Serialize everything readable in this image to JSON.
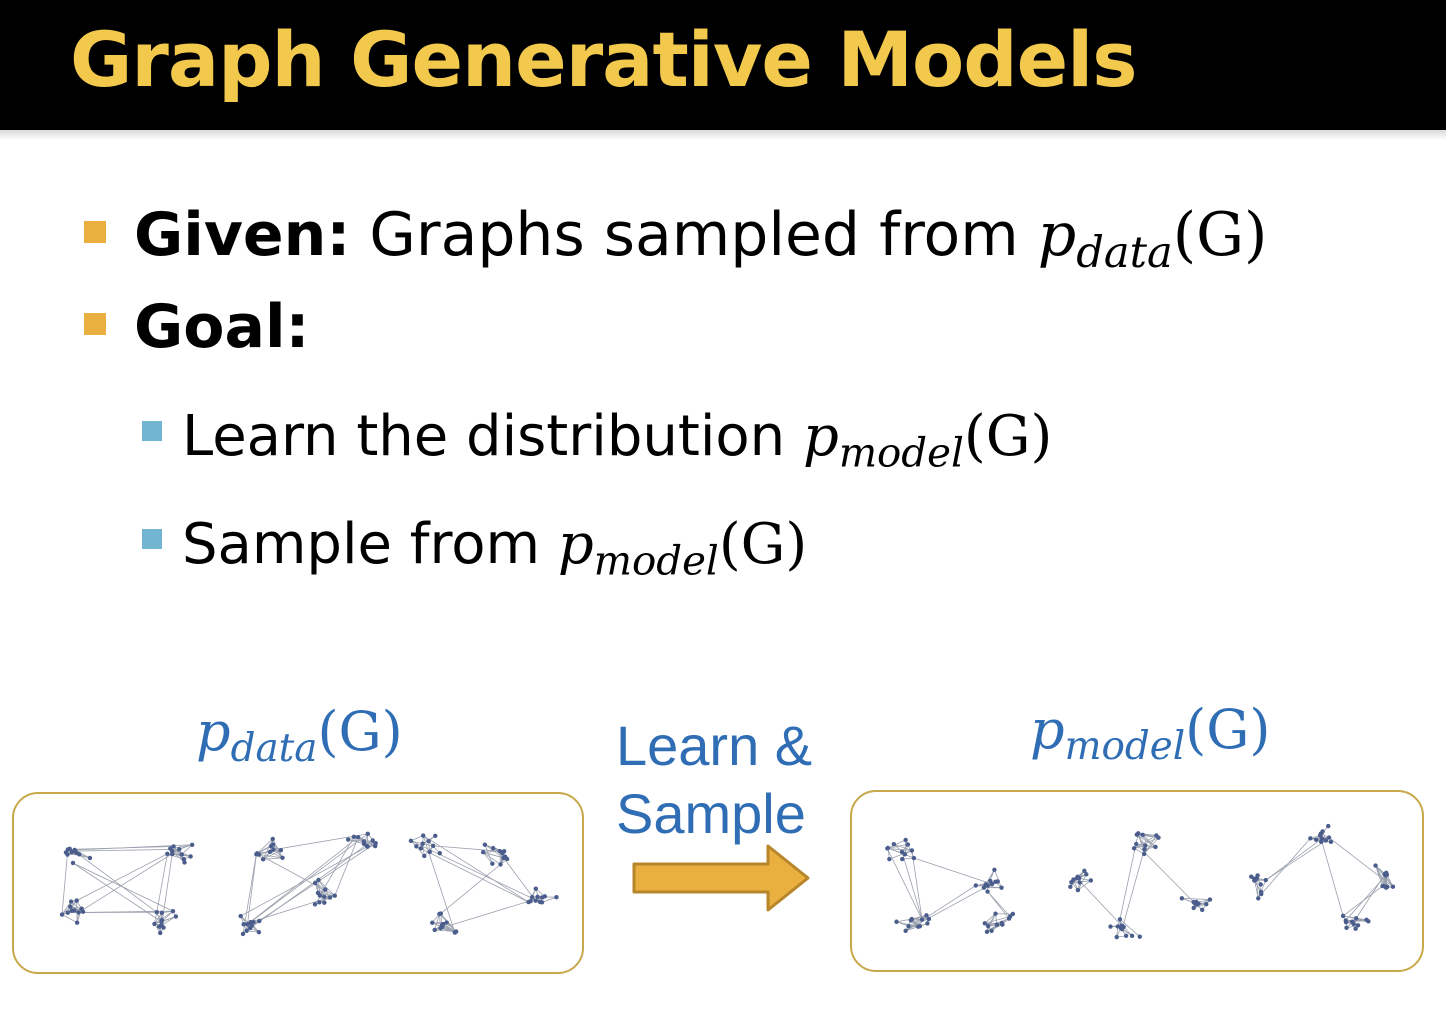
{
  "slide": {
    "title": "Graph Generative Models",
    "bullets": [
      {
        "label": "Given:",
        "text": "Graphs sampled from ",
        "math": {
          "base": "p",
          "sub": "data",
          "arg": "(G)"
        }
      },
      {
        "label": "Goal:"
      }
    ],
    "sub_bullets": [
      {
        "text": "Learn the distribution ",
        "math": {
          "base": "p",
          "sub": "model",
          "arg": "(G)"
        }
      },
      {
        "text": "Sample from ",
        "math": {
          "base": "p",
          "sub": "model",
          "arg": "(G)"
        }
      }
    ]
  },
  "diagram": {
    "left_label": {
      "base": "p",
      "sub": "data",
      "arg": "(G)"
    },
    "right_label": {
      "base": "p",
      "sub": "model",
      "arg": "(G)"
    },
    "arrow_text": [
      "Learn &",
      "Sample"
    ],
    "colors": {
      "title": "#f2c94c",
      "bullet_primary": "#e9b040",
      "bullet_secondary": "#72b5d0",
      "label_blue": "#2f6db4",
      "arrow_fill": "#e9b040",
      "arrow_stroke": "#b8862a",
      "panel_border": "#c7a84a",
      "node": "#4a5d8c",
      "edge": "#9aa0ad"
    }
  }
}
